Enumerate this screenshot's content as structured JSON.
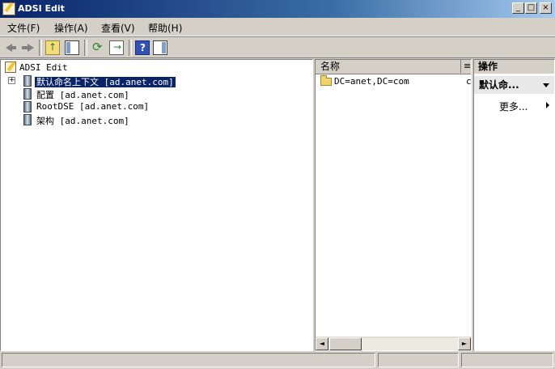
{
  "window": {
    "title": "ADSI Edit",
    "min_symbol": "_",
    "max_symbol": "□",
    "close_symbol": "×"
  },
  "menu": {
    "items": [
      "文件(F)",
      "操作(A)",
      "查看(V)",
      "帮助(H)"
    ]
  },
  "toolbar": {
    "icons": [
      "back-icon",
      "forward-icon",
      "up-folder-icon",
      "show-hide-console-tree-icon",
      "refresh-icon",
      "export-list-icon",
      "help-icon",
      "show-hide-action-pane-icon"
    ]
  },
  "tree": {
    "root_label": "ADSI Edit",
    "expander_symbol": "+",
    "nodes": [
      {
        "label": "默认命名上下文 [ad.anet.com]",
        "selected": true
      },
      {
        "label": "配置 [ad.anet.com]"
      },
      {
        "label": "RootDSE [ad.anet.com]"
      },
      {
        "label": "架构 [ad.anet.com]"
      }
    ]
  },
  "list": {
    "column_name": "名称",
    "column_next": "≡",
    "items": [
      "DC=anet,DC=com"
    ],
    "trailing_char": "c"
  },
  "actions": {
    "header": "操作",
    "section": "默认命...",
    "more": "更多..."
  },
  "scroll": {
    "left_symbol": "◄",
    "right_symbol": "►"
  }
}
